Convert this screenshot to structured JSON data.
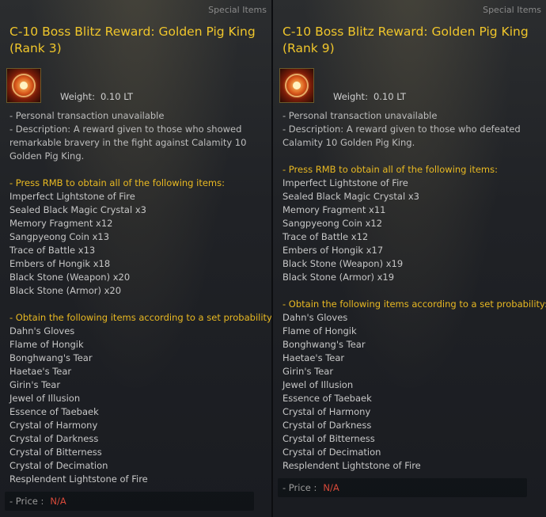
{
  "tooltips": [
    {
      "category": "Special Items",
      "title": "C-10 Boss Blitz Reward: Golden Pig King (Rank 3)",
      "weight_label": "Weight:",
      "weight_value": "0.10 LT",
      "transaction": "- Personal transaction unavailable",
      "description": "- Description: A reward given to those who showed remarkable bravery in the fight against Calamity 10 Golden Pig King.",
      "guaranteed_header": "- Press RMB to obtain all of the following items:",
      "guaranteed_items": [
        "Imperfect Lightstone of Fire",
        "Sealed Black Magic Crystal x3",
        "Memory Fragment x12",
        "Sangpyeong Coin x13",
        "Trace of Battle x13",
        "Embers of Hongik x18",
        "Black Stone (Weapon) x20",
        "Black Stone (Armor) x20"
      ],
      "probability_header": "- Obtain the following items according to a set probability:",
      "probability_items": [
        "Dahn's Gloves",
        "Flame of Hongik",
        "Bonghwang's Tear",
        "Haetae's Tear",
        "Girin's Tear",
        "Jewel of Illusion",
        "Essence of Taebaek",
        "Crystal of Harmony",
        "Crystal of Darkness",
        "Crystal of Bitterness",
        "Crystal of Decimation",
        "Resplendent Lightstone of Fire"
      ],
      "price_label": "- Price :",
      "price_value": "N/A"
    },
    {
      "category": "Special Items",
      "title": "C-10 Boss Blitz Reward: Golden Pig King (Rank 9)",
      "weight_label": "Weight:",
      "weight_value": "0.10 LT",
      "transaction": "- Personal transaction unavailable",
      "description": "- Description: A reward given to those who defeated Calamity 10 Golden Pig King.",
      "guaranteed_header": "- Press RMB to obtain all of the following items:",
      "guaranteed_items": [
        "Imperfect Lightstone of Fire",
        "Sealed Black Magic Crystal x3",
        "Memory Fragment x11",
        "Sangpyeong Coin x12",
        "Trace of Battle x12",
        "Embers of Hongik x17",
        "Black Stone (Weapon) x19",
        "Black Stone (Armor) x19"
      ],
      "probability_header": "- Obtain the following items according to a set probability:",
      "probability_items": [
        "Dahn's Gloves",
        "Flame of Hongik",
        "Bonghwang's Tear",
        "Haetae's Tear",
        "Girin's Tear",
        "Jewel of Illusion",
        "Essence of Taebaek",
        "Crystal of Harmony",
        "Crystal of Darkness",
        "Crystal of Bitterness",
        "Crystal of Decimation",
        "Resplendent Lightstone of Fire"
      ],
      "price_label": "- Price :",
      "price_value": "N/A"
    }
  ]
}
